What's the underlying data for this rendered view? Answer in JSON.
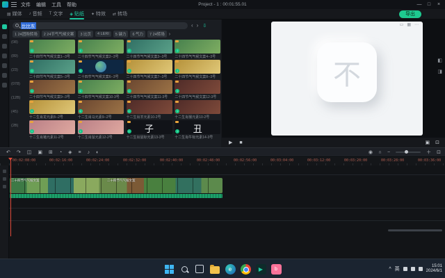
{
  "titlebar": {
    "title": "Project - 1 : 00:01:55.01",
    "menu": [
      "文件",
      "编辑",
      "工具",
      "帮助"
    ],
    "window": {
      "min": "—",
      "max": "□",
      "close": "×"
    }
  },
  "tabs": {
    "export_label": "导出",
    "items": [
      {
        "label": "媒体",
        "glyph": "▤"
      },
      {
        "label": "音频",
        "glyph": "♪"
      },
      {
        "label": "文字",
        "glyph": "T"
      },
      {
        "label": "贴纸",
        "glyph": "◈"
      },
      {
        "label": "特效",
        "glyph": "✦"
      },
      {
        "label": "转场",
        "glyph": "⇄"
      }
    ]
  },
  "media": {
    "search": {
      "value": "比比东",
      "prev": "‹",
      "next": "›",
      "batch_icon": "⇩"
    },
    "chips": [
      {
        "label": "1 24团购转场"
      },
      {
        "label": "2 24节气气候文案"
      },
      {
        "label": "3 比页"
      },
      {
        "label": "4 LERI"
      },
      {
        "label": "5 键力"
      },
      {
        "label": "6 气力"
      },
      {
        "label": "7 24转场"
      }
    ],
    "chips_more": "›",
    "folders": [
      {
        "label": "(08)"
      },
      {
        "label": "(89)"
      },
      {
        "label": "(23)"
      },
      {
        "label": "(078)"
      },
      {
        "label": "(12B)"
      },
      {
        "label": "(45)"
      },
      {
        "label": "(2B)"
      }
    ],
    "download_glyph": "↓",
    "items": [
      {
        "label": "二十四节气气候文案1--3号"
      },
      {
        "label": "二十四节气气候文案2--3号"
      },
      {
        "label": "二十四节气气候文案3--3号"
      },
      {
        "label": "二十四节气气候文案4--3号"
      },
      {
        "label": "二十四节气气候文案5--3号"
      },
      {
        "label": "二十四节气气候文案6--3号"
      },
      {
        "label": "二十四节气气候文案7--3号"
      },
      {
        "label": "二十四节气气候文案8--3号"
      },
      {
        "label": "二十四节气气候文案9--3号"
      },
      {
        "label": "二十四节气气候文案10-3号"
      },
      {
        "label": "二十四节气气候文案11-3号"
      },
      {
        "label": "二十四节气气候文案12-3号"
      },
      {
        "label": "十二生肖龙元素8--2号"
      },
      {
        "label": "十二生肖马元素9--2号"
      },
      {
        "label": "十二生肖羊元素10-2号"
      },
      {
        "label": "十二生肖猴元素10-2号"
      },
      {
        "label": "十二生肖猪元素11-2号"
      },
      {
        "label": "十二生肖鼠元素12-2号"
      },
      {
        "label": "十二生肖鼠标元素13-3号",
        "glyph": "子"
      },
      {
        "label": "十二生肖牛标元素14-3号",
        "glyph": "丑"
      }
    ]
  },
  "preview": {
    "glyph": "不",
    "top_icons": [
      {
        "name": "display-ratio-icon",
        "glyph": "▭"
      },
      {
        "name": "grid-icon",
        "glyph": "▦"
      },
      {
        "name": "more-icon",
        "glyph": "⋯"
      }
    ],
    "side_icons": [
      {
        "glyph": "◧"
      },
      {
        "glyph": "◨"
      }
    ]
  },
  "player": {
    "play": "▶",
    "stop": "■",
    "snapshot": "▣",
    "fullscreen": "⊡"
  },
  "timeline": {
    "toolbar_left": [
      {
        "name": "undo-icon",
        "glyph": "↶"
      },
      {
        "name": "redo-icon",
        "glyph": "↷"
      },
      {
        "name": "split-icon",
        "glyph": "◫"
      },
      {
        "name": "crop-icon",
        "glyph": "▣"
      },
      {
        "name": "add-marker-icon",
        "glyph": "⊞"
      },
      {
        "name": "speed-icon",
        "glyph": "◔"
      },
      {
        "name": "keyframe-icon",
        "glyph": "◈"
      },
      {
        "name": "properties-icon",
        "glyph": "≡"
      },
      {
        "name": "audio-icon",
        "glyph": "♪"
      },
      {
        "name": "color-icon",
        "glyph": "◐"
      }
    ],
    "toolbar_right": [
      {
        "name": "record-icon",
        "glyph": "◉"
      },
      {
        "name": "snap-icon",
        "glyph": "∩"
      },
      {
        "name": "zoom-out-icon",
        "glyph": "−"
      },
      {
        "name": "zoom-in-icon",
        "glyph": "＋"
      },
      {
        "name": "fit-timeline-icon",
        "glyph": "⊡"
      }
    ],
    "ruler": [
      "00:02:08:00",
      "00:02:16:00",
      "00:02:24:00",
      "00:02:32:00",
      "00:02:40:00",
      "00:02:48:00",
      "00:02:56:00",
      "00:03:04:00",
      "00:03:12:00",
      "00:03:20:00",
      "00:03:28:00",
      "00:03:36:00"
    ],
    "clip": {
      "label1": "二十四节气气候文案",
      "label2": "二十四节气气候文案"
    }
  },
  "taskbar": {
    "edge_glyph": "e",
    "filmora_glyph": "▶",
    "bili_glyph": "b",
    "tray": {
      "caret": "^",
      "ime": "英",
      "time": "15:01",
      "date": "2024/6/1"
    }
  }
}
